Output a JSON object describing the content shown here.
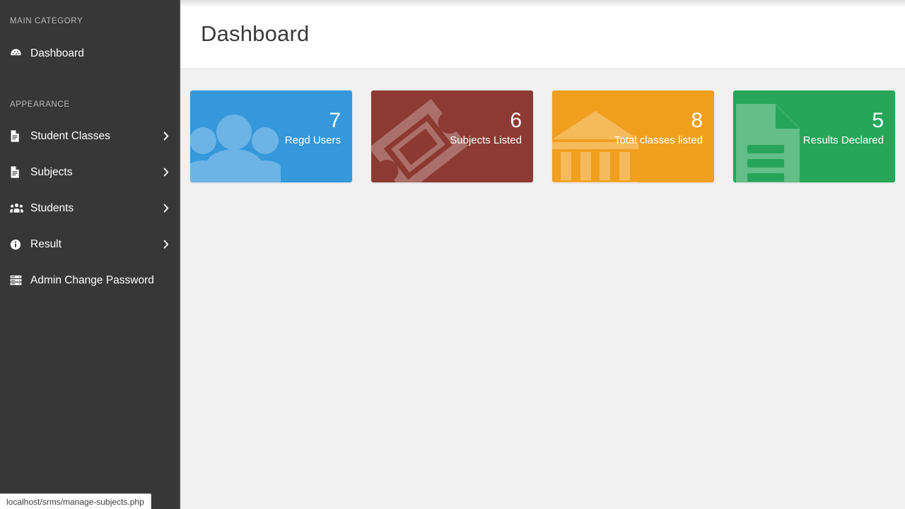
{
  "sidebar": {
    "sections": [
      {
        "heading": "MAIN CATEGORY"
      },
      {
        "heading": "APPEARANCE"
      }
    ],
    "items": [
      {
        "label": "Dashboard",
        "icon": "tachometer-icon",
        "chevron": false
      },
      {
        "label": "Student Classes",
        "icon": "file-text-icon",
        "chevron": true
      },
      {
        "label": "Subjects",
        "icon": "file-text-icon",
        "chevron": true
      },
      {
        "label": "Students",
        "icon": "users-group-icon",
        "chevron": true
      },
      {
        "label": "Result",
        "icon": "info-circle-icon",
        "chevron": true
      },
      {
        "label": "Admin Change Password",
        "icon": "server-list-icon",
        "chevron": false
      }
    ],
    "chevron_icon": "chevron-right-icon",
    "bg_color": "#373737",
    "text_color": "#ffffff",
    "heading_color": "#b9b9b9"
  },
  "header": {
    "title": "Dashboard",
    "bg_color": "#ffffff"
  },
  "cards": [
    {
      "value": "7",
      "label": "Regd Users",
      "color": "#3498db",
      "icon": "users-group-icon"
    },
    {
      "value": "6",
      "label": "Subjects Listed",
      "color": "#8c3a33",
      "icon": "ticket-icon"
    },
    {
      "value": "8",
      "label": "Total classes listed",
      "color": "#f0a01e",
      "icon": "bank-icon"
    },
    {
      "value": "5",
      "label": "Results Declared",
      "color": "#27a65a",
      "icon": "file-lines-icon"
    }
  ],
  "statusbar": {
    "url": "localhost/srms/manage-subjects.php"
  },
  "content": {
    "bg_color": "#f1f1f1"
  }
}
